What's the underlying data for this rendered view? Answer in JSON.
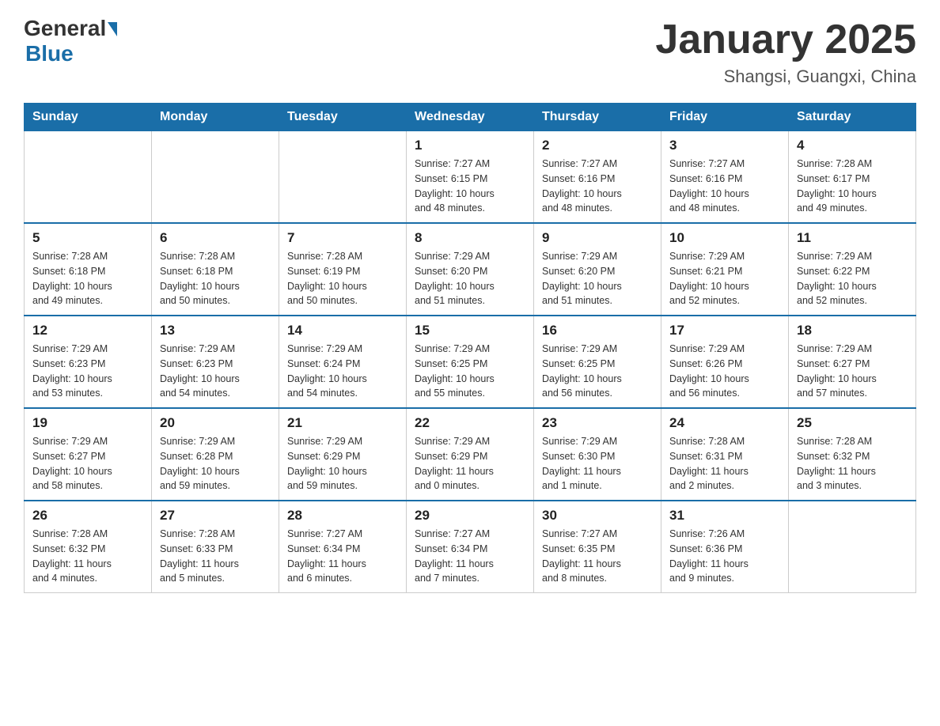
{
  "header": {
    "logo_general": "General",
    "logo_blue": "Blue",
    "title": "January 2025",
    "subtitle": "Shangsi, Guangxi, China"
  },
  "days_of_week": [
    "Sunday",
    "Monday",
    "Tuesday",
    "Wednesday",
    "Thursday",
    "Friday",
    "Saturday"
  ],
  "weeks": [
    [
      {
        "day": "",
        "info": ""
      },
      {
        "day": "",
        "info": ""
      },
      {
        "day": "",
        "info": ""
      },
      {
        "day": "1",
        "info": "Sunrise: 7:27 AM\nSunset: 6:15 PM\nDaylight: 10 hours\nand 48 minutes."
      },
      {
        "day": "2",
        "info": "Sunrise: 7:27 AM\nSunset: 6:16 PM\nDaylight: 10 hours\nand 48 minutes."
      },
      {
        "day": "3",
        "info": "Sunrise: 7:27 AM\nSunset: 6:16 PM\nDaylight: 10 hours\nand 48 minutes."
      },
      {
        "day": "4",
        "info": "Sunrise: 7:28 AM\nSunset: 6:17 PM\nDaylight: 10 hours\nand 49 minutes."
      }
    ],
    [
      {
        "day": "5",
        "info": "Sunrise: 7:28 AM\nSunset: 6:18 PM\nDaylight: 10 hours\nand 49 minutes."
      },
      {
        "day": "6",
        "info": "Sunrise: 7:28 AM\nSunset: 6:18 PM\nDaylight: 10 hours\nand 50 minutes."
      },
      {
        "day": "7",
        "info": "Sunrise: 7:28 AM\nSunset: 6:19 PM\nDaylight: 10 hours\nand 50 minutes."
      },
      {
        "day": "8",
        "info": "Sunrise: 7:29 AM\nSunset: 6:20 PM\nDaylight: 10 hours\nand 51 minutes."
      },
      {
        "day": "9",
        "info": "Sunrise: 7:29 AM\nSunset: 6:20 PM\nDaylight: 10 hours\nand 51 minutes."
      },
      {
        "day": "10",
        "info": "Sunrise: 7:29 AM\nSunset: 6:21 PM\nDaylight: 10 hours\nand 52 minutes."
      },
      {
        "day": "11",
        "info": "Sunrise: 7:29 AM\nSunset: 6:22 PM\nDaylight: 10 hours\nand 52 minutes."
      }
    ],
    [
      {
        "day": "12",
        "info": "Sunrise: 7:29 AM\nSunset: 6:23 PM\nDaylight: 10 hours\nand 53 minutes."
      },
      {
        "day": "13",
        "info": "Sunrise: 7:29 AM\nSunset: 6:23 PM\nDaylight: 10 hours\nand 54 minutes."
      },
      {
        "day": "14",
        "info": "Sunrise: 7:29 AM\nSunset: 6:24 PM\nDaylight: 10 hours\nand 54 minutes."
      },
      {
        "day": "15",
        "info": "Sunrise: 7:29 AM\nSunset: 6:25 PM\nDaylight: 10 hours\nand 55 minutes."
      },
      {
        "day": "16",
        "info": "Sunrise: 7:29 AM\nSunset: 6:25 PM\nDaylight: 10 hours\nand 56 minutes."
      },
      {
        "day": "17",
        "info": "Sunrise: 7:29 AM\nSunset: 6:26 PM\nDaylight: 10 hours\nand 56 minutes."
      },
      {
        "day": "18",
        "info": "Sunrise: 7:29 AM\nSunset: 6:27 PM\nDaylight: 10 hours\nand 57 minutes."
      }
    ],
    [
      {
        "day": "19",
        "info": "Sunrise: 7:29 AM\nSunset: 6:27 PM\nDaylight: 10 hours\nand 58 minutes."
      },
      {
        "day": "20",
        "info": "Sunrise: 7:29 AM\nSunset: 6:28 PM\nDaylight: 10 hours\nand 59 minutes."
      },
      {
        "day": "21",
        "info": "Sunrise: 7:29 AM\nSunset: 6:29 PM\nDaylight: 10 hours\nand 59 minutes."
      },
      {
        "day": "22",
        "info": "Sunrise: 7:29 AM\nSunset: 6:29 PM\nDaylight: 11 hours\nand 0 minutes."
      },
      {
        "day": "23",
        "info": "Sunrise: 7:29 AM\nSunset: 6:30 PM\nDaylight: 11 hours\nand 1 minute."
      },
      {
        "day": "24",
        "info": "Sunrise: 7:28 AM\nSunset: 6:31 PM\nDaylight: 11 hours\nand 2 minutes."
      },
      {
        "day": "25",
        "info": "Sunrise: 7:28 AM\nSunset: 6:32 PM\nDaylight: 11 hours\nand 3 minutes."
      }
    ],
    [
      {
        "day": "26",
        "info": "Sunrise: 7:28 AM\nSunset: 6:32 PM\nDaylight: 11 hours\nand 4 minutes."
      },
      {
        "day": "27",
        "info": "Sunrise: 7:28 AM\nSunset: 6:33 PM\nDaylight: 11 hours\nand 5 minutes."
      },
      {
        "day": "28",
        "info": "Sunrise: 7:27 AM\nSunset: 6:34 PM\nDaylight: 11 hours\nand 6 minutes."
      },
      {
        "day": "29",
        "info": "Sunrise: 7:27 AM\nSunset: 6:34 PM\nDaylight: 11 hours\nand 7 minutes."
      },
      {
        "day": "30",
        "info": "Sunrise: 7:27 AM\nSunset: 6:35 PM\nDaylight: 11 hours\nand 8 minutes."
      },
      {
        "day": "31",
        "info": "Sunrise: 7:26 AM\nSunset: 6:36 PM\nDaylight: 11 hours\nand 9 minutes."
      },
      {
        "day": "",
        "info": ""
      }
    ]
  ]
}
